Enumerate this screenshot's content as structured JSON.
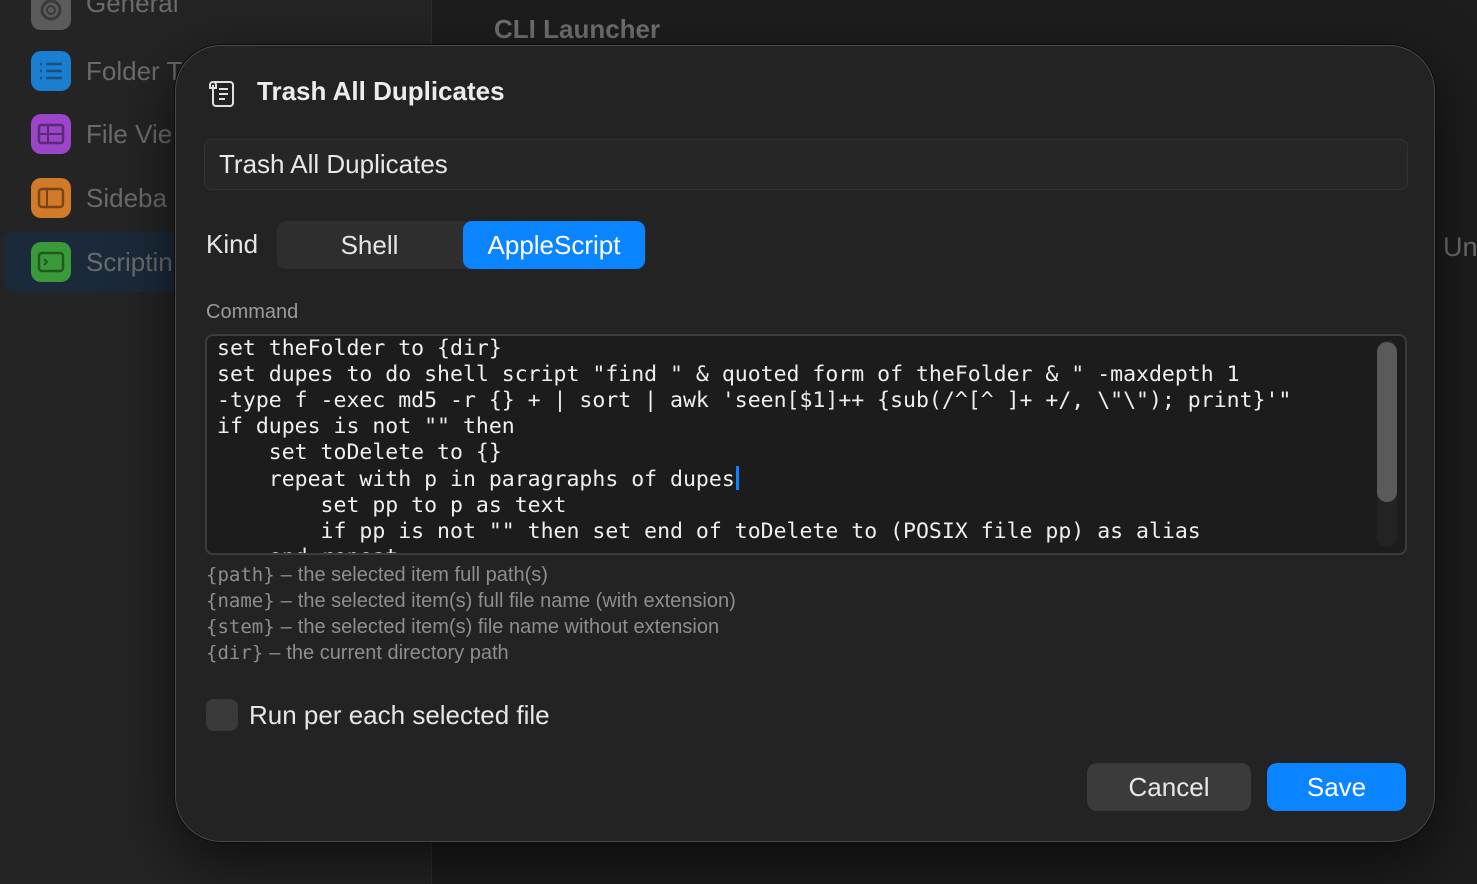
{
  "background": {
    "sidebar": {
      "items": [
        {
          "label": "General",
          "icon": "gear-icon",
          "color": "#5b5b5b"
        },
        {
          "label": "Folder T",
          "icon": "list-icon",
          "color": "#1a7fd0"
        },
        {
          "label": "File Vie",
          "icon": "table-icon",
          "color": "#9b45c8"
        },
        {
          "label": "Sideba",
          "icon": "sidebar-icon",
          "color": "#d07a2a"
        },
        {
          "label": "Scriptin",
          "icon": "terminal-icon",
          "color": "#3a9a3a"
        }
      ]
    },
    "main_title": "CLI Launcher",
    "right_partial_text": "Un"
  },
  "dialog": {
    "title": "Trash All Duplicates",
    "header_icon": "scroll-icon",
    "name_value": "Trash All Duplicates",
    "kind": {
      "label": "Kind",
      "options": [
        "Shell",
        "AppleScript"
      ],
      "selected": "AppleScript"
    },
    "command": {
      "label": "Command",
      "lines": [
        "set theFolder to {dir}",
        "set dupes to do shell script \"find \" & quoted form of theFolder & \" -maxdepth 1",
        "-type f -exec md5 -r {} + | sort | awk 'seen[$1]++ {sub(/^[^ ]+ +/, \\\"\\\"); print}'\"",
        "if dupes is not \"\" then",
        "    set toDelete to {}",
        "    repeat with p in paragraphs of dupes",
        "        set pp to p as text",
        "        if pp is not \"\" then set end of toDelete to (POSIX file pp) as alias",
        "    end repeat"
      ]
    },
    "hints": [
      {
        "token": "{path}",
        "text": "the selected item full path(s)"
      },
      {
        "token": "{name}",
        "text": "the selected item(s) full file name (with extension)"
      },
      {
        "token": "{stem}",
        "text": "the selected item(s) file name without extension"
      },
      {
        "token": "{dir}",
        "text": "the current directory path"
      }
    ],
    "hint_separator": "–",
    "run_per_file": {
      "label": "Run per each selected file",
      "checked": false
    },
    "buttons": {
      "cancel": "Cancel",
      "save": "Save"
    },
    "accent_color": "#0a84ff"
  }
}
